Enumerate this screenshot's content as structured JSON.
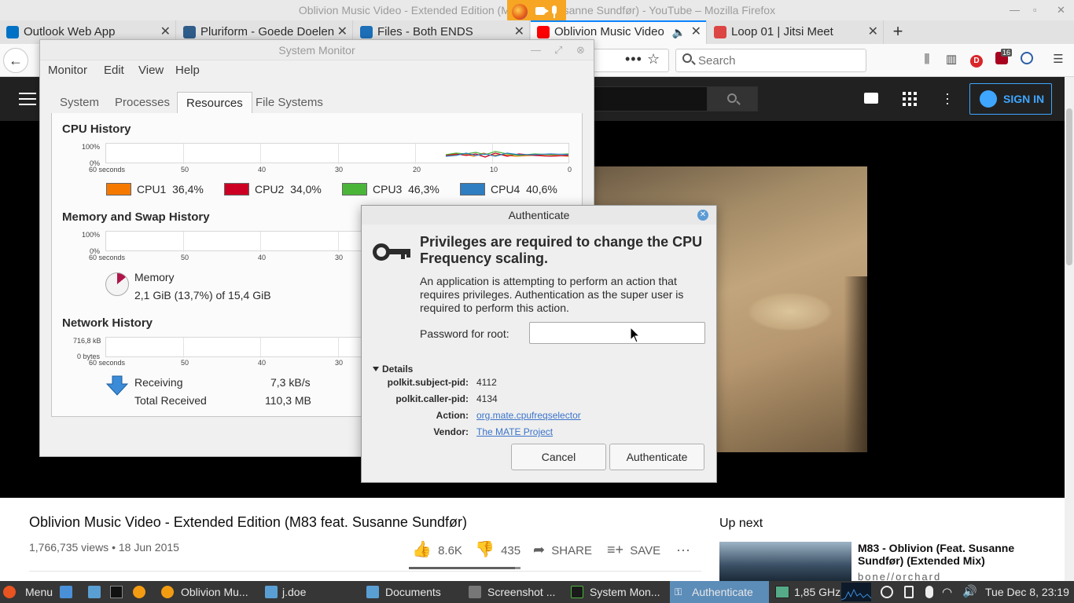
{
  "firefox": {
    "window_title": "Oblivion Music Video - Extended Edition (M83 feat. Susanne Sundfør) - YouTube – Mozilla Firefox",
    "tabs": [
      {
        "label": "Outlook Web App",
        "color": "#0072c6"
      },
      {
        "label": "Pluriform - Goede Doelen",
        "color": "#2f5d8a"
      },
      {
        "label": "Files - Both ENDS",
        "color": "#1d6fb8"
      },
      {
        "label": "Oblivion Music Video",
        "color": "#ff0000"
      },
      {
        "label": "Loop 01 | Jitsi Meet",
        "color": "#d44"
      }
    ],
    "new_tab": "+",
    "url_dots": "•••",
    "search_placeholder": "Search",
    "badge_count": "16"
  },
  "youtube": {
    "signin_label": "SIGN IN",
    "video_title": "Oblivion Music Video - Extended Edition (M83 feat. Susanne Sundfør)",
    "views": "1,766,735 views • 18 Jun 2015",
    "likes": "8.6K",
    "dislikes": "435",
    "share_label": "SHARE",
    "save_label": "SAVE",
    "like_ratio": 0.95,
    "up_next_label": "Up next",
    "up_next_title": "M83 - Oblivion (Feat. Susanne Sundfør) (Extended Mix)",
    "up_next_channel": "bone//orchard"
  },
  "system_monitor": {
    "title": "System Monitor",
    "menu": [
      "Monitor",
      "Edit",
      "View",
      "Help"
    ],
    "tabs": [
      "System",
      "Processes",
      "Resources",
      "File Systems"
    ],
    "active_tab": "Resources",
    "cpu": {
      "heading": "CPU History",
      "y_top": "100%",
      "y_bottom": "0%",
      "x_ticks": [
        "60 seconds",
        "50",
        "40",
        "30",
        "20",
        "10",
        "0"
      ],
      "cores": [
        {
          "label": "CPU1",
          "value": "36,4%",
          "color": "#f57900"
        },
        {
          "label": "CPU2",
          "value": "34,0%",
          "color": "#cc0022"
        },
        {
          "label": "CPU3",
          "value": "46,3%",
          "color": "#4bb53a"
        },
        {
          "label": "CPU4",
          "value": "40,6%",
          "color": "#2f7ec2"
        }
      ]
    },
    "memory": {
      "heading": "Memory and Swap History",
      "y_top": "100%",
      "y_bottom": "0%",
      "x_ticks": [
        "60 seconds",
        "50",
        "40",
        "30"
      ],
      "label": "Memory",
      "value": "2,1 GiB (13,7%) of 15,4 GiB"
    },
    "network": {
      "heading": "Network History",
      "y_top": "716,8 kB",
      "y_bottom": "0 bytes",
      "x_ticks": [
        "60 seconds",
        "50",
        "40",
        "30"
      ],
      "receiving_label": "Receiving",
      "receiving_value": "7,3 kB/s",
      "total_label": "Total Received",
      "total_value": "110,3 MB"
    }
  },
  "auth_dialog": {
    "title": "Authenticate",
    "heading": "Privileges are required to change the CPU Frequency scaling.",
    "body": "An application is attempting to perform an action that requires privileges. Authentication as the super user is required to perform this action.",
    "password_label": "Password for root:",
    "password_value": "",
    "details_label": "Details",
    "details": [
      {
        "key": "polkit.subject-pid:",
        "value": "4112",
        "link": false
      },
      {
        "key": "polkit.caller-pid:",
        "value": "4134",
        "link": false
      },
      {
        "key": "Action:",
        "value": "org.mate.cpufreqselector",
        "link": true
      },
      {
        "key": "Vendor:",
        "value": "The MATE Project",
        "link": true
      }
    ],
    "cancel_label": "Cancel",
    "authenticate_label": "Authenticate"
  },
  "taskbar": {
    "menu_label": "Menu",
    "items": [
      {
        "label": "Oblivion Mu...",
        "icon": "firefox-icon"
      },
      {
        "label": "j.doe",
        "icon": "folder-icon"
      },
      {
        "label": "Documents",
        "icon": "folder-icon"
      },
      {
        "label": "Screenshot ...",
        "icon": "screenshot-icon"
      },
      {
        "label": "System Mon...",
        "icon": "system-monitor-icon"
      },
      {
        "label": "Authenticate",
        "icon": "key-icon"
      }
    ],
    "cpu_freq": "1,85 GHz",
    "clock": "Tue Dec  8, 23:19"
  }
}
